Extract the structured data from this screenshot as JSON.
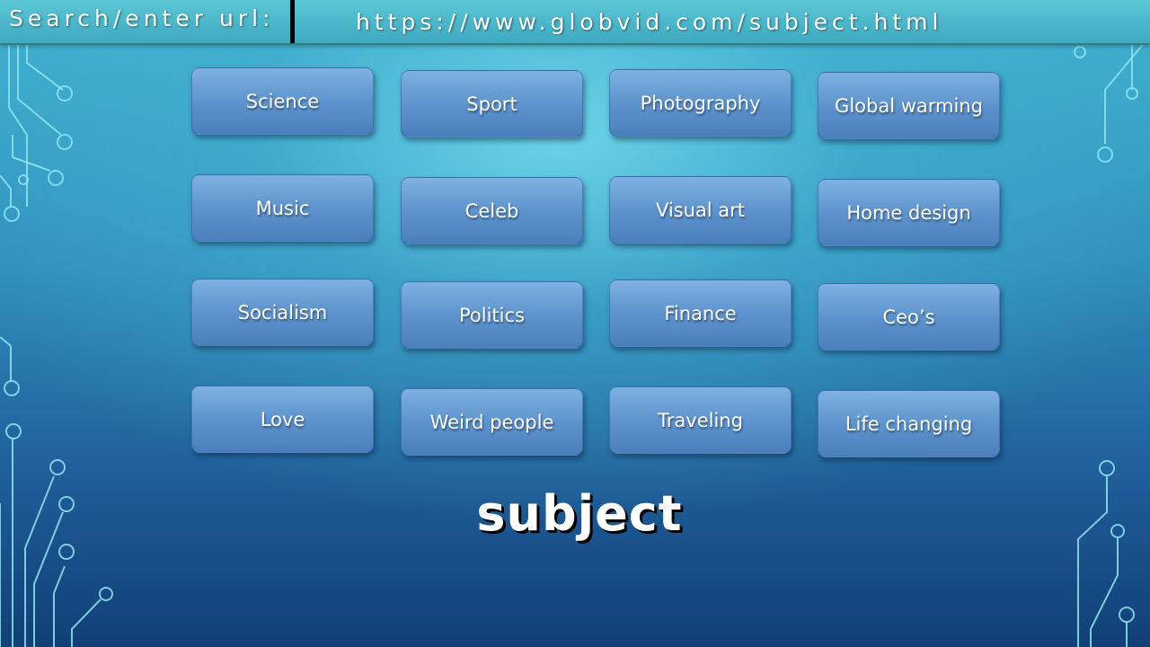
{
  "address_bar": {
    "label": "Search/enter url:",
    "url": "https://www.globvid.com/subject.html"
  },
  "subjects": [
    [
      "Science",
      "Sport",
      "Photography",
      "Global warming"
    ],
    [
      "Music",
      "Celeb",
      "Visual art",
      "Home design"
    ],
    [
      "Socialism",
      "Politics",
      "Finance",
      "Ceo’s"
    ],
    [
      "Love",
      "Weird people",
      "Traveling",
      "Life changing"
    ]
  ],
  "page": {
    "title": "subject"
  },
  "colors": {
    "button_top": "#7fb1e2",
    "button_bottom": "#4a7fbd",
    "circuit": "#8fe4f0",
    "address_bar": "#4fb8cb"
  }
}
